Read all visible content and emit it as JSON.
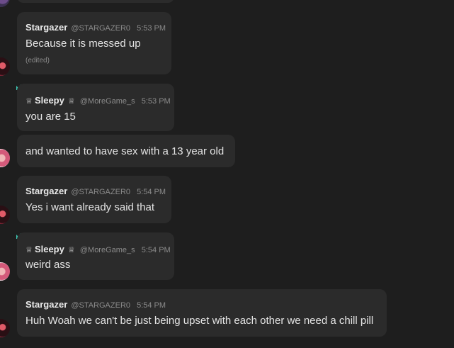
{
  "messages": [
    {
      "user": "Stargazer",
      "handle": "@STARGAZER0",
      "time": "5:53 PM",
      "text": "Because it is messed up",
      "edited": "(edited)"
    },
    {
      "user": "Sleepy",
      "handle": "@MoreGame_s",
      "time": "5:53 PM",
      "text": "you are 15",
      "crown_left": "♕",
      "crown_right": "♕"
    },
    {
      "text": "and wanted to have sex with a 13 year old"
    },
    {
      "user": "Stargazer",
      "handle": "@STARGAZER0",
      "time": "5:54 PM",
      "text": "Yes i want already said that"
    },
    {
      "user": "Sleepy",
      "handle": "@MoreGame_s",
      "time": "5:54 PM",
      "text": "weird ass",
      "crown_left": "♕",
      "crown_right": "♕"
    },
    {
      "user": "Stargazer",
      "handle": "@STARGAZER0",
      "time": "5:54 PM",
      "text": "Huh Woah we can't be just being upset with each other we need a chill pill"
    }
  ],
  "icons": {
    "crown_badge": "crown-icon",
    "avatar": "user-avatar"
  },
  "colors": {
    "background": "#1e1e1e",
    "bubble": "#2b2b2b",
    "crown_teal": "#3fc7b4"
  }
}
